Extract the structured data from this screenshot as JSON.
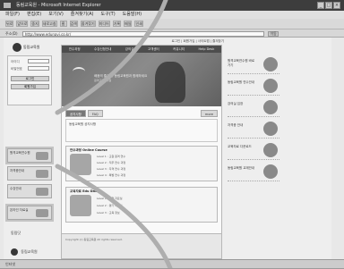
{
  "window": {
    "title": "동림교육원 - Microsoft Internet Explorer",
    "menu": [
      "파일(F)",
      "편집(E)",
      "보기(V)",
      "즐겨찾기(A)",
      "도구(T)",
      "도움말(H)"
    ],
    "toolbar": [
      "뒤로",
      "앞으로",
      "중지",
      "새로고침",
      "홈",
      "검색",
      "즐겨찾기",
      "미디어",
      "기록",
      "메일",
      "인쇄"
    ],
    "address_label": "주소(D)",
    "address": "http://www.edunavi.co.kr/",
    "go_label": "이동",
    "status": "인터넷"
  },
  "site": {
    "toplinks": "로그인 | 회원가입 | 사이트맵 | 즐겨찾기",
    "logo_text": "동림교육원",
    "login": {
      "id_label": "아이디",
      "pw_label": "비밀번호",
      "login_button": "로그인",
      "join_button": "회원가입"
    },
    "left_buttons": [
      "원격교육연수원",
      "자격증안내",
      "수강안내",
      "온라인 자료실"
    ],
    "left_bottom": "동림닷",
    "nav": [
      "연수과정",
      "수강신청안내",
      "강의실",
      "고객센터",
      "커뮤니티",
      "Help Desk"
    ],
    "hero_line1": "배움의 즐거움, 동림교육원과 함께하세요",
    "hero_line2": "원격교육연수원",
    "tabs": [
      "공지사항",
      "FAQ",
      "more"
    ],
    "notice_text": "동림교육원 공지사항",
    "cards": [
      {
        "title": "연수과정 Online Course",
        "lines": [
          "Level 1 : 교원 원격 연수",
          "Level 2 : 직무 연수 과정",
          "Level 3 : 자격 연수 과정",
          "Level 4 : 특별 연수 과정"
        ]
      },
      {
        "title": "교육자료 Edu Data",
        "lines": [
          "Level 1 : 수업 자료실",
          "Level 2 : 평가 자료실",
          "Level 3 : 교육 정보"
        ]
      }
    ],
    "footer_text": "Copyright (c) 동림교육원 All rights reserved.",
    "right_banners": [
      "원격교육연수원 바로가기",
      "동림교육원 연수안내",
      "강의실 입장",
      "자격증 안내",
      "교육자료 다운로드",
      "동림교육원 교재안내"
    ],
    "bottom_logo": "동림교육원"
  },
  "colors": {
    "highlight_arrow": "#b0b0b0"
  }
}
